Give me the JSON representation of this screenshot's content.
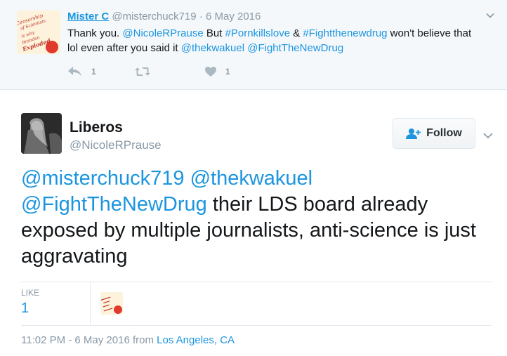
{
  "reply": {
    "name": "Mister C",
    "handle": "@misterchuck719",
    "separator": "·",
    "date": "6 May 2016",
    "avatar_text": [
      "Censorship",
      "of Scientists",
      "is why",
      "Brandon",
      "Exploded"
    ],
    "text_parts": [
      {
        "t": "Thank you. ",
        "link": false
      },
      {
        "t": "@NicoleRPrause",
        "link": true
      },
      {
        "t": " But ",
        "link": false
      },
      {
        "t": "#Pornkillslove",
        "link": true
      },
      {
        "t": " & ",
        "link": false
      },
      {
        "t": "#Fightthenewdrug",
        "link": true
      },
      {
        "t": " won't believe that lol even after you said it ",
        "link": false
      },
      {
        "t": "@thekwakuel",
        "link": true
      },
      {
        "t": " ",
        "link": false
      },
      {
        "t": "@FightTheNewDrug",
        "link": true
      }
    ],
    "actions": {
      "reply_count": "1",
      "retweet_count": "",
      "like_count": "1"
    }
  },
  "tweet": {
    "name": "Liberos",
    "handle": "@NicoleRPrause",
    "follow_label": "Follow",
    "text_parts": [
      {
        "t": "@misterchuck719",
        "link": true
      },
      {
        "t": " ",
        "link": false
      },
      {
        "t": "@thekwakuel",
        "link": true
      },
      {
        "t": " ",
        "link": false
      },
      {
        "t": "@FightTheNewDrug",
        "link": true
      },
      {
        "t": " their LDS board already exposed by multiple journalists, anti-science is just aggravating",
        "link": false
      }
    ],
    "stats": {
      "like_label": "LIKE",
      "like_count": "1"
    },
    "footer": {
      "time": "11:02 PM - 6 May 2016",
      "from_label": " from ",
      "location": "Los Angeles, CA"
    }
  },
  "colors": {
    "link": "#1b95e0",
    "muted": "#8899a6",
    "reply_bg": "#f5f8fa",
    "border": "#e1e8ed"
  }
}
